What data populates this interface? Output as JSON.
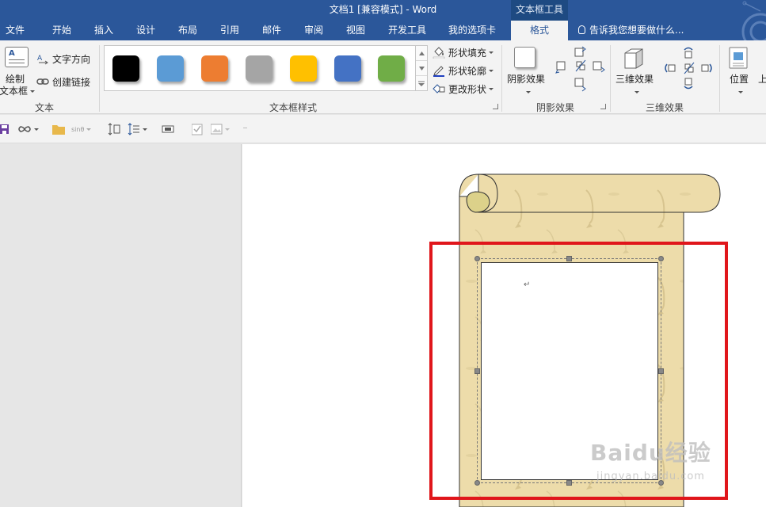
{
  "window": {
    "title": "文档1 [兼容模式] - Word",
    "tool_context": "文本框工具"
  },
  "tabs": [
    {
      "label": "文件"
    },
    {
      "label": "开始"
    },
    {
      "label": "插入"
    },
    {
      "label": "设计"
    },
    {
      "label": "布局"
    },
    {
      "label": "引用"
    },
    {
      "label": "邮件"
    },
    {
      "label": "审阅"
    },
    {
      "label": "视图"
    },
    {
      "label": "开发工具"
    },
    {
      "label": "我的选项卡"
    },
    {
      "label": "格式",
      "active": true
    }
  ],
  "tell_me": "告诉我您想要做什么...",
  "ribbon": {
    "text_group": {
      "draw_textbox_line1": "绘制",
      "draw_textbox_line2": "文本框",
      "text_direction": "文字方向",
      "create_link": "创建链接",
      "label": "文本"
    },
    "style_group": {
      "label": "文本框样式",
      "swatches": [
        "#000000",
        "#5b9bd5",
        "#ed7d31",
        "#a5a5a5",
        "#ffc000",
        "#4472c4",
        "#70ad47"
      ],
      "shape_fill": "形状填充",
      "shape_outline": "形状轮廓",
      "change_shape": "更改形状"
    },
    "shadow_group": {
      "shadow_effects": "阴影效果",
      "label": "阴影效果"
    },
    "three_d_group": {
      "three_d_effects": "三维效果",
      "label": "三维效果"
    },
    "arrange_group": {
      "position": "位置",
      "partial": "上"
    }
  },
  "qat": {
    "equation_label": "sinθ"
  },
  "document": {
    "paragraph_mark": "↵"
  },
  "watermark": {
    "main": "Baidu经验",
    "sub": "jingyan.baidu.com"
  }
}
